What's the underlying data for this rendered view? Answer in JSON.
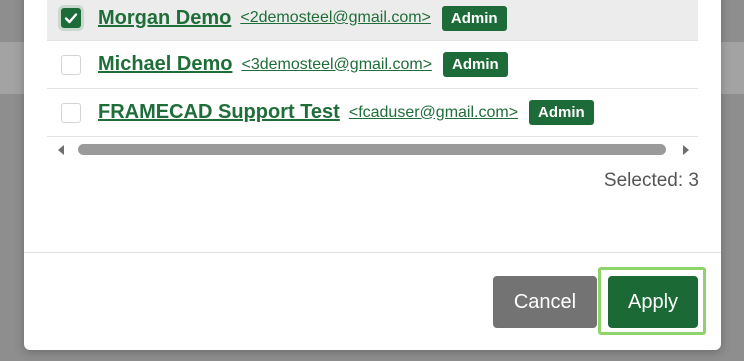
{
  "users": [
    {
      "name": "Morgan Demo",
      "email": "<2demosteel@gmail.com>",
      "role": "Admin",
      "checked": true
    },
    {
      "name": "Michael Demo",
      "email": "<3demosteel@gmail.com>",
      "role": "Admin",
      "checked": false
    },
    {
      "name": "FRAMECAD Support Test",
      "email": "<fcaduser@gmail.com>",
      "role": "Admin",
      "checked": false
    }
  ],
  "selection": {
    "summary": "Selected: 3"
  },
  "footer": {
    "cancel_label": "Cancel",
    "apply_label": "Apply"
  },
  "icons": {
    "checkbox_checked": "check-icon",
    "scroll_left": "chevron-left-icon",
    "scroll_right": "chevron-right-icon"
  },
  "colors": {
    "accent": "#1c6b38",
    "link": "#1f6e39",
    "cancel": "#737373",
    "highlight": "#8fd36a"
  }
}
